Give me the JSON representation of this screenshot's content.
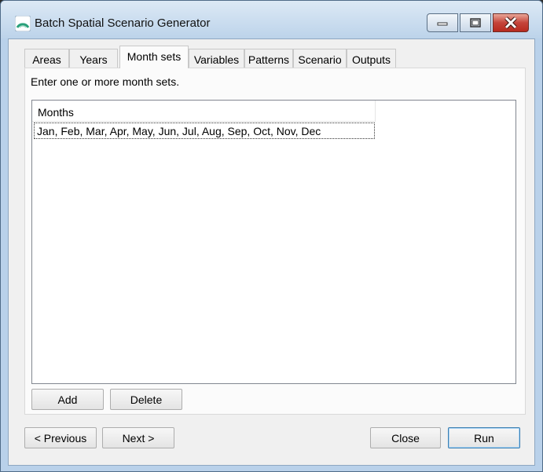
{
  "window": {
    "title": "Batch Spatial Scenario Generator"
  },
  "tabs": [
    {
      "label": "Areas",
      "active": false
    },
    {
      "label": "Years",
      "active": false
    },
    {
      "label": "Month sets",
      "active": true
    },
    {
      "label": "Variables",
      "active": false
    },
    {
      "label": "Patterns",
      "active": false
    },
    {
      "label": "Scenario",
      "active": false
    },
    {
      "label": "Outputs",
      "active": false
    }
  ],
  "panel": {
    "instruction": "Enter one or more month sets.",
    "grid": {
      "column_header": "Months",
      "rows": [
        "Jan, Feb, Mar, Apr, May, Jun, Jul, Aug, Sep, Oct, Nov, Dec"
      ]
    },
    "add_label": "Add",
    "delete_label": "Delete"
  },
  "footer": {
    "previous_label": "< Previous",
    "next_label": "Next >",
    "close_label": "Close",
    "run_label": "Run"
  },
  "colors": {
    "titlebar": "#c4d9ee",
    "client_bg": "#f0f0f0",
    "close_button": "#c5443a",
    "default_button_border": "#3c7fb1"
  },
  "icons": {
    "app": "arc-logo-icon",
    "minimize": "minimize-icon",
    "maximize": "maximize-icon",
    "close": "close-icon"
  }
}
